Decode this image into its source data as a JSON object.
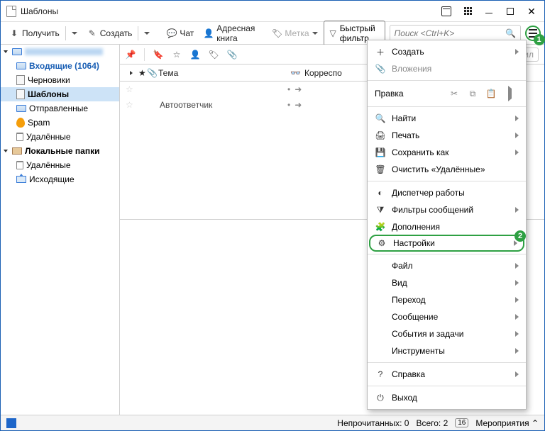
{
  "window": {
    "title": "Шаблоны"
  },
  "toolbar": {
    "get": "Получить",
    "create": "Создать",
    "chat": "Чат",
    "address_book": "Адресная книга",
    "tag": "Метка",
    "quick_filter": "Быстрый фильтр",
    "search_placeholder": "Поиск <Ctrl+K>"
  },
  "sidebar": {
    "account": "",
    "items": [
      {
        "label": "Входящие (1064)"
      },
      {
        "label": "Черновики"
      },
      {
        "label": "Шаблоны"
      },
      {
        "label": "Отправленные"
      },
      {
        "label": "Spam"
      },
      {
        "label": "Удалённые"
      }
    ],
    "local": "Локальные папки",
    "local_items": [
      {
        "label": "Удалённые"
      },
      {
        "label": "Исходящие"
      }
    ]
  },
  "filter": {
    "mini": "Фил"
  },
  "columns": {
    "theme": "Тема",
    "correspondents": "Корреспо"
  },
  "rows": [
    {
      "theme": "Автоответчик"
    }
  ],
  "menu": {
    "create": "Создать",
    "attachments": "Вложения",
    "edit": "Правка",
    "find": "Найти",
    "print": "Печать",
    "saveas": "Сохранить как",
    "empty_trash": "Очистить «Удалённые»",
    "activity": "Диспетчер работы",
    "msgfilters": "Фильтры сообщений",
    "addons": "Дополнения",
    "settings": "Настройки",
    "file": "Файл",
    "view": "Вид",
    "go": "Переход",
    "message": "Сообщение",
    "events": "События и задачи",
    "tools": "Инструменты",
    "help": "Справка",
    "quit": "Выход"
  },
  "statusbar": {
    "unread": "Непрочитанных: 0",
    "total": "Всего: 2",
    "events_count": "16",
    "events": "Мероприятия"
  },
  "callouts": {
    "one": "1",
    "two": "2"
  }
}
